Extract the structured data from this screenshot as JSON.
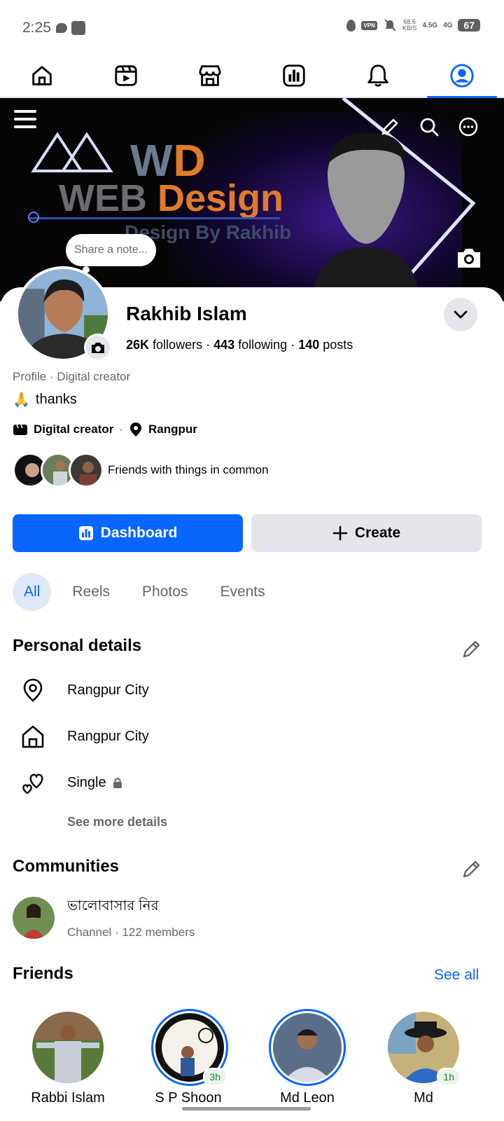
{
  "status_bar": {
    "time": "2:25",
    "vpn": "VPN",
    "speed_value": "68.6",
    "speed_unit": "KB/S",
    "net1": "4.5G",
    "net2": "4G",
    "battery": "67"
  },
  "nav": {
    "items": [
      "home-icon",
      "video-icon",
      "marketplace-icon",
      "dashboard-icon",
      "notifications-icon",
      "profile-icon"
    ],
    "active": "profile-icon",
    "accent": "#0866ff"
  },
  "cover": {
    "logo_wd_1": "W",
    "logo_wd_2": "D",
    "logo_web_1": "WEB ",
    "logo_web_2": "Design",
    "logo_by": "Design By Rakhib"
  },
  "profile": {
    "note_placeholder": "Share a note...",
    "name": "Rakhib Islam",
    "followers_count": "26K",
    "followers_label": "followers",
    "following_count": "443",
    "following_label": "following",
    "posts_count": "140",
    "posts_label": "posts",
    "subtitle": "Profile · Digital creator",
    "bio_emoji": "🙏",
    "bio_text": "thanks",
    "category": "Digital creator",
    "location": "Rangpur",
    "friends_common": "Friends with things in common"
  },
  "actions": {
    "dashboard_label": "Dashboard",
    "create_label": "Create"
  },
  "tabs": [
    "All",
    "Reels",
    "Photos",
    "Events"
  ],
  "personal_details": {
    "title": "Personal details",
    "items": [
      {
        "icon": "location-pin-icon",
        "text": "Rangpur City"
      },
      {
        "icon": "home-icon",
        "text": "Rangpur City"
      },
      {
        "icon": "hearts-icon",
        "text": "Single"
      }
    ],
    "see_more": "See more details"
  },
  "communities": {
    "title": "Communities",
    "items": [
      {
        "name": "ভালোবাসার নির",
        "meta": "Channel · 122 members"
      }
    ]
  },
  "friends": {
    "title": "Friends",
    "see_all": "See all",
    "items": [
      {
        "name": "Rabbi Islam",
        "badge": ""
      },
      {
        "name": "S P Shoon",
        "badge": "3h"
      },
      {
        "name": "Md Leon",
        "badge": ""
      },
      {
        "name": "Md",
        "badge": "1h"
      }
    ]
  }
}
